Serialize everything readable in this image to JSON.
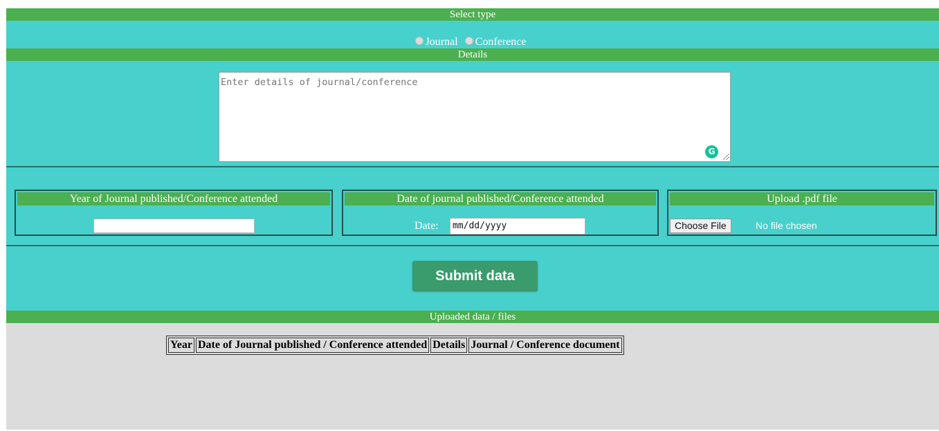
{
  "select_type": {
    "header": "Select type",
    "options": [
      "Journal",
      "Conference"
    ]
  },
  "details": {
    "header": "Details",
    "placeholder": "Enter details of journal/conference",
    "grammarly_label": "G"
  },
  "fields": {
    "year": {
      "header": "Year of Journal published/Conference attended",
      "value": ""
    },
    "date": {
      "header": "Date of journal published/Conference attended",
      "label": "Date:",
      "placeholder": "mm/dd/yyyy"
    },
    "upload": {
      "header": "Upload .pdf file",
      "button_label": "Choose File",
      "status": "No file chosen"
    }
  },
  "submit": {
    "label": "Submit data"
  },
  "uploaded": {
    "header": "Uploaded data / files",
    "columns": [
      "Year",
      "Date of Journal published / Conference attended",
      "Details",
      "Journal / Conference document"
    ]
  },
  "colors": {
    "green_bar": "#4caf50",
    "teal_background": "#48d0cc",
    "submit_button": "#3a9b6c",
    "gray_background": "#dcdcdc"
  }
}
